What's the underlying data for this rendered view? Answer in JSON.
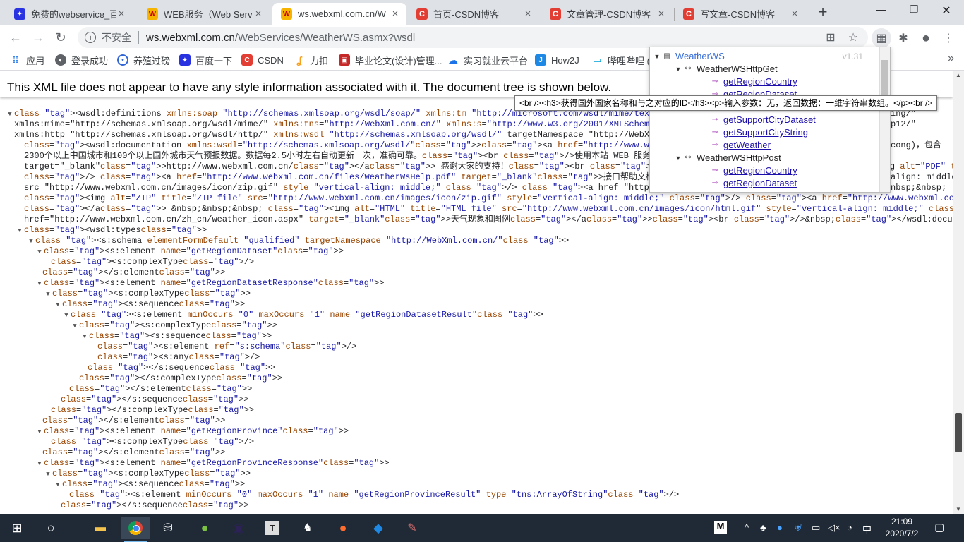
{
  "browser": {
    "tabs": [
      {
        "title": "免费的webservice_百度",
        "icon": "baidu-paw-icon",
        "active": false
      },
      {
        "title": "WEB服务（Web Servic",
        "icon": "webxml-logo-icon",
        "active": false
      },
      {
        "title": "ws.webxml.com.cn/W",
        "icon": "webxml-logo-icon",
        "active": true
      },
      {
        "title": "首页-CSDN博客",
        "icon": "csdn-icon",
        "active": false
      },
      {
        "title": "文章管理-CSDN博客",
        "icon": "csdn-icon",
        "active": false
      },
      {
        "title": "写文章-CSDN博客",
        "icon": "csdn-icon",
        "active": false
      }
    ],
    "insecure_label": "不安全",
    "url_host": "ws.webxml.com.cn",
    "url_path": "/WebServices/WeatherWS.asmx?wsdl",
    "bookmarks": [
      {
        "label": "应用",
        "icon": "apps-grid-icon"
      },
      {
        "label": "登录成功",
        "icon": "globe-icon"
      },
      {
        "label": "养殖过磅",
        "icon": "target-icon"
      },
      {
        "label": "百度一下",
        "icon": "baidu-paw-icon"
      },
      {
        "label": "CSDN",
        "icon": "csdn-icon"
      },
      {
        "label": "力扣",
        "icon": "leetcode-icon"
      },
      {
        "label": "毕业论文(设计)管理...",
        "icon": "thesis-icon"
      },
      {
        "label": "实习就业云平台",
        "icon": "cloud-platform-icon"
      },
      {
        "label": "How2J",
        "icon": "how2j-icon"
      },
      {
        "label": "哔哩哔哩 (",
        "icon": "bilibili-icon"
      }
    ]
  },
  "notice": "This XML file does not appear to have any style information associated with it. The document tree is shown below.",
  "xml_lines": [
    "<wsdl:definitions xmlns:soap=\"http://schemas.xmlsoap.org/wsdl/soap/\" xmlns:tm=\"http://microsoft.com/wsdl/mime/textMatching/\" xmlns",
    "xmlns:mime=\"http://schemas.xmlsoap.org/wsdl/mime/\" xmlns:tns=\"http://WebXml.com.cn/\" xmlns:s=\"http://www.w3.org/2001/XMLSchema\" x",
    "xmlns:http=\"http://schemas.xmlsoap.org/wsdl/http/\" xmlns:wsdl=\"http://schemas.xmlsoap.org/wsdl/\" targetNamespace=\"http://WebXml.c",
    "<wsdl:documentation xmlns:wsdl=\"http://schemas.xmlsoap.org/wsdl/\"><a href=\"http://www.webxml.com.cn/\" target=\"_blank\">WebXml.co",
    "2300个以上中国城市和100个以上国外城市天气预报数据。数据每2.5小时左右自动更新一次，准确可靠。<br />使用本站 WEB 服务请注明或链接",
    "target=\"_blank\">http://www.webxml.com.cn/</a> 感谢大家的支持！<br /><br /><img alt=\"PDF\" title=\"PDF file\" src=\"http://www.webxm",
    "/> <a href=\"http://www.webxml.com.cn/files/WeatherWsHelp.pdf\" target=\"_blank\">接口帮助文档</a> &nbsp;&nbsp;&nbsp; <img alt=\"ZIP",
    "src=\"http://www.webxml.com.cn/images/icon/zip.gif\" style=\"vertical-align: middle;\" /> <a href=\"http://www.webxml.com.cn/files/a",
    "<img alt=\"ZIP\" title=\"ZIP file\" src=\"http://www.webxml.com.cn/images/icon/zip.gif\" style=\"vertical-align: middle;\" /> <a href=\"http://www.webxml.com.cn/files/city_photo.zip\">部分城市图片",
    "</a> &nbsp;&nbsp;&nbsp; <img alt=\"HTML\" title=\"HTML file\" src=\"http://www.webxml.com.cn/images/icon/html.gif\" style=\"vertical-align: middle;\" /> <a",
    "href=\"http://www.webxml.com.cn/zh_cn/weather_icon.aspx\" target=\"_blank\">天气现象和图例</a><br />&nbsp;</wsdl:documentation>",
    "<wsdl:types>",
    "<s:schema elementFormDefault=\"qualified\" targetNamespace=\"http://WebXml.com.cn/\">",
    "<s:element name=\"getRegionDataset\">",
    "<s:complexType/>",
    "</s:element>",
    "<s:element name=\"getRegionDatasetResponse\">",
    "<s:complexType>",
    "<s:sequence>",
    "<s:element minOccurs=\"0\" maxOccurs=\"1\" name=\"getRegionDatasetResult\">",
    "<s:complexType>",
    "<s:sequence>",
    "<s:element ref=\"s:schema\"/>",
    "<s:any/>",
    "</s:sequence>",
    "</s:complexType>",
    "</s:element>",
    "</s:sequence>",
    "</s:complexType>",
    "</s:element>",
    "<s:element name=\"getRegionProvince\">",
    "<s:complexType/>",
    "</s:element>",
    "<s:element name=\"getRegionProvinceResponse\">",
    "<s:complexType>",
    "<s:sequence>",
    "<s:element minOccurs=\"0\" maxOccurs=\"1\" name=\"getRegionProvinceResult\" type=\"tns:ArrayOfString\"/>",
    "</s:sequence>"
  ],
  "xml_line_extras": {
    "0": "ing/\"",
    "1": "p12/\"",
    "3": "cong)，包含",
    "6": "align: middle;\"",
    "7": "nbsp;&nbsp;"
  },
  "wsdl_panel": {
    "version": "v1.31",
    "root": "WeatherWS",
    "nodes": [
      {
        "kind": "binding",
        "label": "WeatherWSHttpGet"
      },
      {
        "kind": "op",
        "label": "getRegionCountry"
      },
      {
        "kind": "op",
        "label": "getRegionDataset"
      },
      {
        "kind": "op",
        "label": "getSupportCityDataset"
      },
      {
        "kind": "op",
        "label": "getSupportCityString"
      },
      {
        "kind": "op",
        "label": "getWeather"
      },
      {
        "kind": "binding",
        "label": "WeatherWSHttpPost"
      },
      {
        "kind": "op",
        "label": "getRegionCountry"
      },
      {
        "kind": "op",
        "label": "getRegionDataset"
      }
    ]
  },
  "tooltip": "<br /><h3>获得国外国家名称和与之对应的ID</h3><p>输入参数：无，返回数据：一维字符串数组。</p><br />",
  "taskbar": {
    "time": "21:09",
    "date": "2020/7/2",
    "ime": "中",
    "ime_mode": "M"
  }
}
